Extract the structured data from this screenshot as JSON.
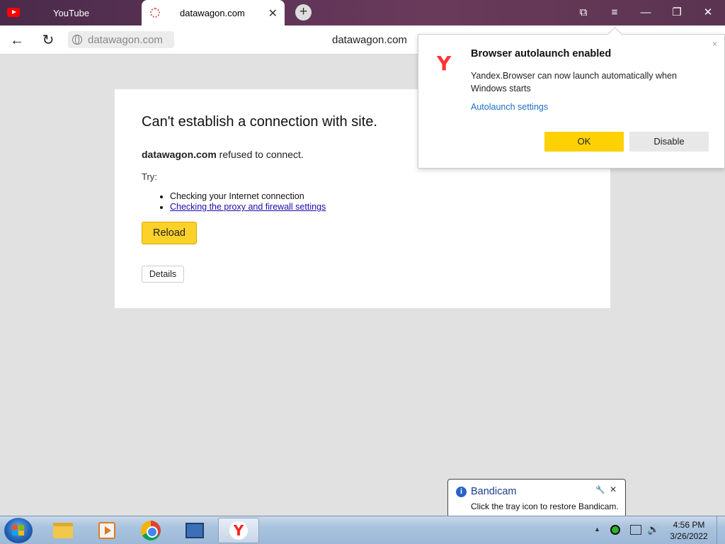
{
  "browser": {
    "tabs": [
      {
        "title": "YouTube",
        "icon": "youtube-icon"
      },
      {
        "title": "datawagon.com",
        "icon": "site-favicon",
        "close": "✕"
      }
    ],
    "new_tab": "+",
    "window_controls": {
      "bookmarks": "⧉",
      "menu": "≡",
      "minimize": "—",
      "restore": "❐",
      "close": "✕"
    },
    "nav": {
      "back": "←",
      "reload": "↻"
    },
    "address": {
      "value": "datawagon.com",
      "page_domain": "datawagon.com"
    }
  },
  "error_page": {
    "title": "Can't establish a connection with site.",
    "domain": "datawagon.com",
    "message": " refused to connect.",
    "try_label": "Try:",
    "suggestions": [
      "Checking your Internet connection",
      "Checking the proxy and firewall settings"
    ],
    "reload_label": "Reload",
    "details_label": "Details"
  },
  "autolaunch_popup": {
    "logo": "Y",
    "close": "×",
    "title": "Browser autolaunch enabled",
    "description": "Yandex.Browser can now launch automatically when Windows starts",
    "link": "Autolaunch settings",
    "ok_label": "OK",
    "disable_label": "Disable",
    "ok_color": "#fed104"
  },
  "bandicam_balloon": {
    "info": "i",
    "title": "Bandicam",
    "message": "Click the tray icon to restore Bandicam.",
    "pin": "🔧",
    "close": "✕"
  },
  "taskbar": {
    "apps": [
      {
        "name": "explorer",
        "icon": "folder-icon"
      },
      {
        "name": "media-player",
        "icon": "media-player-icon"
      },
      {
        "name": "chrome",
        "icon": "chrome-icon"
      },
      {
        "name": "network",
        "icon": "network-icon"
      },
      {
        "name": "yandex-browser",
        "icon": "yandex-icon",
        "label": "Y",
        "active": true
      }
    ],
    "tray_up": "▲",
    "volume": "🔊",
    "clock": {
      "time": "4:56 PM",
      "date": "3/26/2022"
    }
  }
}
